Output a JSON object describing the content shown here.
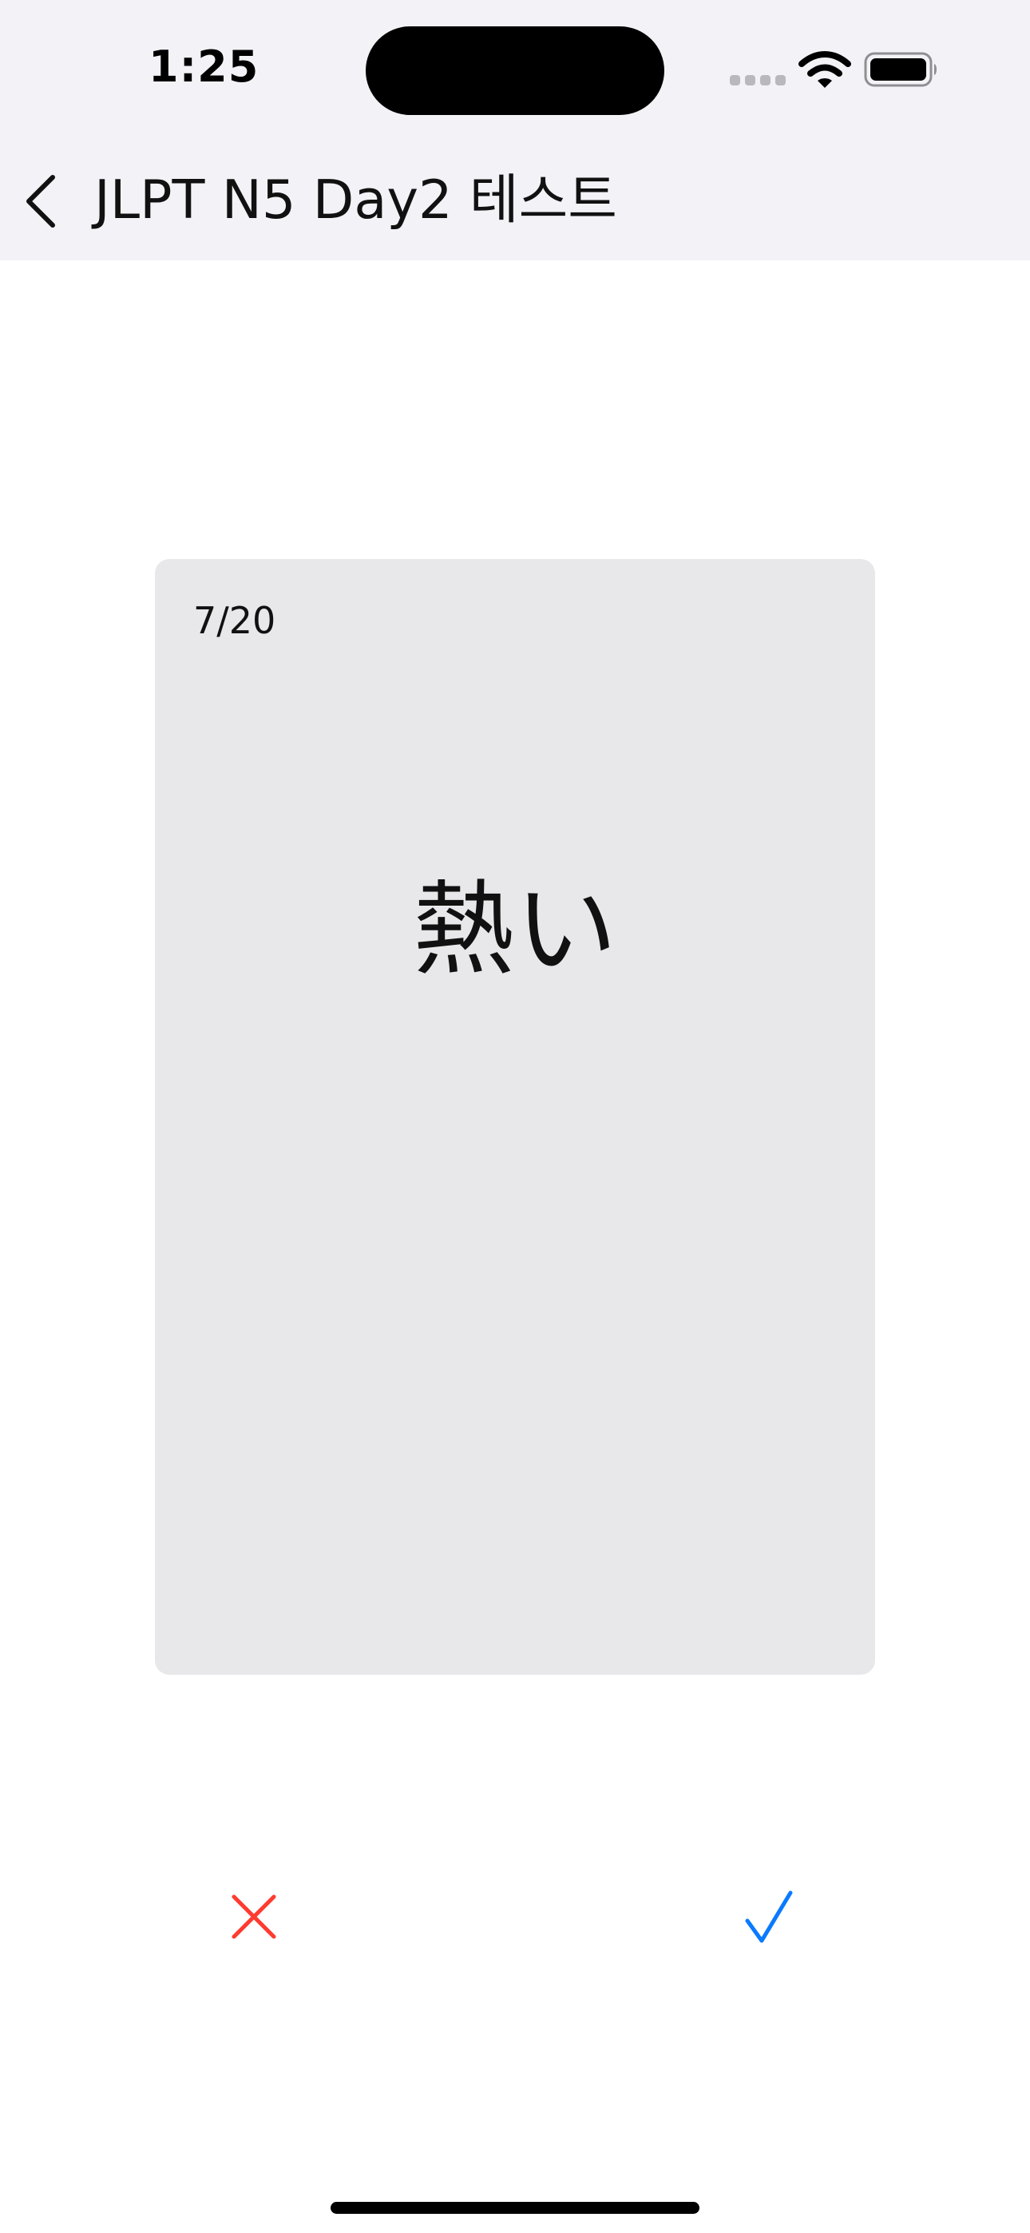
{
  "status_bar": {
    "time": "1:25",
    "icons": [
      "cellular-signal-icon",
      "wifi-icon",
      "battery-icon"
    ]
  },
  "nav": {
    "back_icon": "chevron-left-icon",
    "title": "JLPT N5 Day2 테스트"
  },
  "card": {
    "progress": "7/20",
    "word": "熱い"
  },
  "actions": {
    "wrong_icon": "x-mark-icon",
    "correct_icon": "checkmark-icon"
  },
  "colors": {
    "header_background": "#f2f2f7",
    "card_background": "#e8e8ea",
    "wrong": "#ff3b30",
    "correct": "#0a7aff"
  }
}
